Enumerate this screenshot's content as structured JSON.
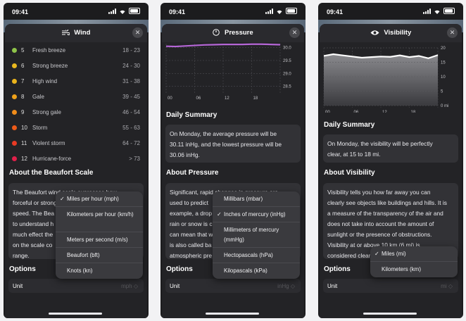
{
  "status_time": "09:41",
  "wind": {
    "title": "Wind",
    "rows": [
      {
        "num": "5",
        "name": "Fresh breeze",
        "range": "18 - 23",
        "color": "#8fc44a"
      },
      {
        "num": "6",
        "name": "Strong breeze",
        "range": "24 - 30",
        "color": "#e9b81f"
      },
      {
        "num": "7",
        "name": "High wind",
        "range": "31 - 38",
        "color": "#ebb41c"
      },
      {
        "num": "8",
        "name": "Gale",
        "range": "39 - 45",
        "color": "#f0a21a"
      },
      {
        "num": "9",
        "name": "Strong gale",
        "range": "46 - 54",
        "color": "#f08c1a"
      },
      {
        "num": "10",
        "name": "Storm",
        "range": "55 - 63",
        "color": "#ee5a18"
      },
      {
        "num": "11",
        "name": "Violent storm",
        "range": "64 - 72",
        "color": "#e83a24"
      },
      {
        "num": "12",
        "name": "Hurricane-force",
        "range": "> 73",
        "color": "#e1204a"
      }
    ],
    "about_heading": "About the Beaufort Scale",
    "about_lines": [
      "The Beaufort wind scale expresses how",
      "forceful or strong",
      "speed. The Bea",
      "to understand h",
      "much effect the",
      "on the scale co",
      "range."
    ],
    "options_heading": "Options",
    "unit_label": "Unit",
    "unit_value": "mph ◇",
    "menu": [
      {
        "label": "Miles per hour (mph)",
        "checked": true
      },
      {
        "label": "Kilometers per hour (km/h)",
        "checked": false
      },
      {
        "label": "Meters per second (m/s)",
        "checked": false
      },
      {
        "label": "Beaufort (bft)",
        "checked": false
      },
      {
        "label": "Knots (kn)",
        "checked": false
      }
    ]
  },
  "pressure": {
    "title": "Pressure",
    "y_ticks": [
      "30.0",
      "29.5",
      "29.0",
      "28.5"
    ],
    "x_ticks": [
      "00",
      "06",
      "12",
      "18"
    ],
    "summary_heading": "Daily Summary",
    "summary_lines": [
      "On Monday, the average pressure will be",
      "30.11 inHg, and the lowest pressure will be",
      "30.06 inHg."
    ],
    "about_heading": "About Pressure",
    "about_lines": [
      "Significant, rapid changes in pressure are",
      "used to predict",
      "example, a drop",
      "rain or snow is c",
      "can mean that w",
      "is also called ba",
      "atmospheric pre"
    ],
    "options_heading": "Options",
    "unit_label": "Unit",
    "unit_value": "inHg ◇",
    "menu": [
      {
        "label": "Millibars (mbar)",
        "checked": false
      },
      {
        "label": "Inches of mercury (inHg)",
        "checked": true
      },
      {
        "label": "Millimeters of mercury (mmHg)",
        "checked": false
      },
      {
        "label": "Hectopascals (hPa)",
        "checked": false
      },
      {
        "label": "Kilopascals (kPa)",
        "checked": false
      }
    ],
    "chart_data": {
      "type": "line",
      "x": [
        0,
        2,
        4,
        6,
        8,
        10,
        12,
        14,
        16,
        18,
        20,
        22,
        24
      ],
      "values": [
        30.05,
        30.04,
        30.06,
        30.08,
        30.1,
        30.11,
        30.12,
        30.12,
        30.12,
        30.13,
        30.13,
        30.12,
        30.11
      ],
      "ylim": [
        28.3,
        30.15
      ],
      "line_color": "#b566d6"
    }
  },
  "visibility": {
    "title": "Visibility",
    "y_ticks": [
      "20",
      "15",
      "10",
      "5",
      "0 mi"
    ],
    "x_ticks": [
      "00",
      "06",
      "12",
      "18"
    ],
    "summary_heading": "Daily Summary",
    "summary_lines": [
      "On Monday, the visibility will be perfectly",
      "clear, at 15 to 18 mi."
    ],
    "about_heading": "About Visibility",
    "about_lines": [
      "Visibility tells you how far away you can",
      "clearly see objects like buildings and hills. It is",
      "a measure of the transparency of the air and",
      "does not take into account the amount of",
      "sunlight or the presence of obstructions.",
      "Visibility at or above 10 km (6 mi) is",
      "considered clear"
    ],
    "options_heading": "Options",
    "unit_label": "Unit",
    "unit_value": "mi ◇",
    "menu": [
      {
        "label": "Miles (mi)",
        "checked": true
      },
      {
        "label": "Kilometers (km)",
        "checked": false
      }
    ],
    "chart_data": {
      "type": "area",
      "x": [
        0,
        2,
        4,
        6,
        8,
        10,
        12,
        14,
        16,
        18,
        20,
        22,
        24
      ],
      "values": [
        17.2,
        17.8,
        17.4,
        17.0,
        16.6,
        16.8,
        17.0,
        16.9,
        17.4,
        16.8,
        17.2,
        16.4,
        17.5
      ],
      "ylim": [
        0,
        20
      ]
    }
  }
}
